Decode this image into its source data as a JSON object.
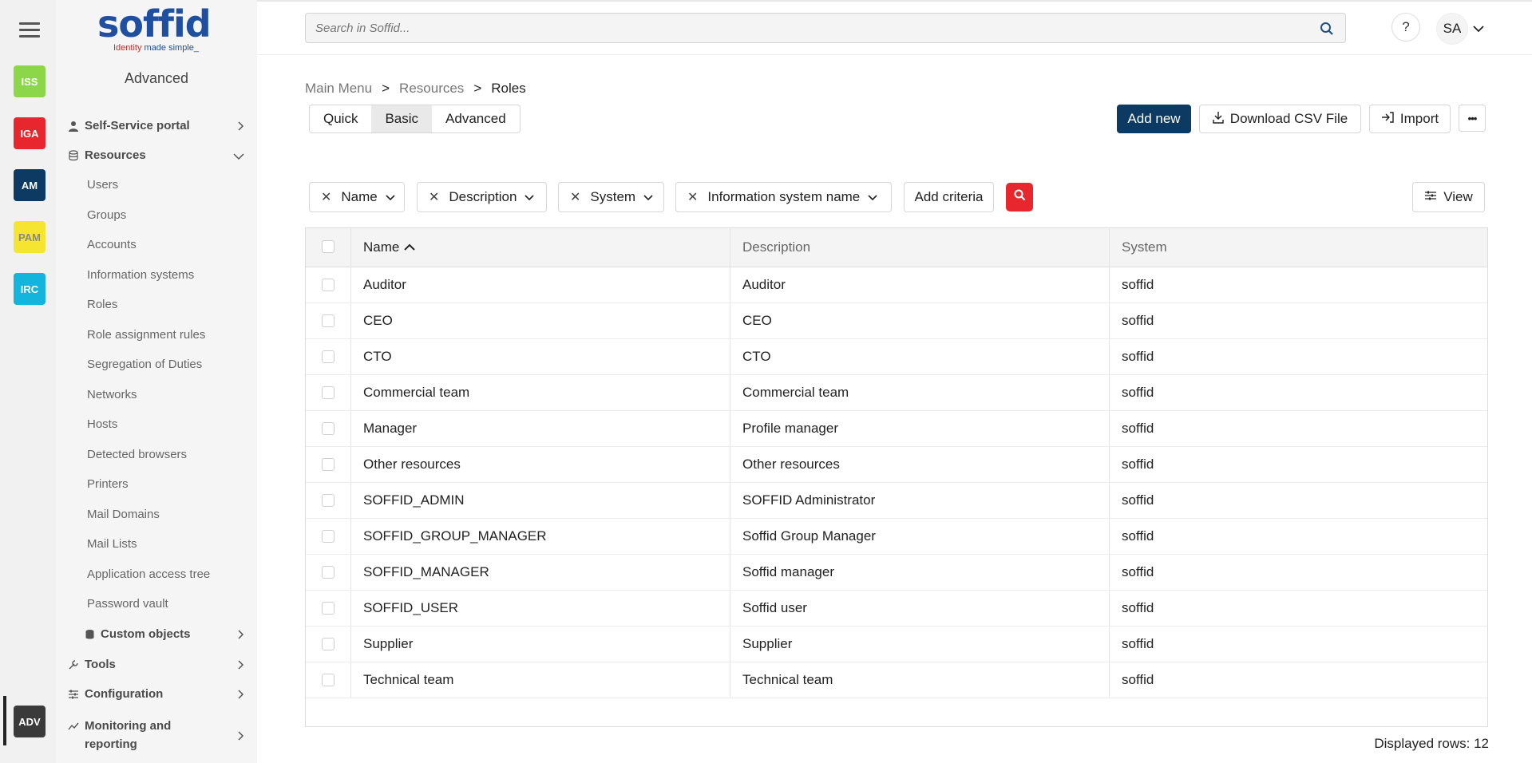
{
  "modules": [
    {
      "label": "ISS",
      "color": "#8cd64a"
    },
    {
      "label": "IGA",
      "color": "#e8262e"
    },
    {
      "label": "AM",
      "color": "#0c3a62"
    },
    {
      "label": "PAM",
      "color": "#f5e530"
    },
    {
      "label": "IRC",
      "color": "#14b5dc"
    },
    {
      "label": "ADV",
      "color": "#3a3a3a"
    }
  ],
  "logo": {
    "word": "soffid",
    "tag_red": "Identity ",
    "tag_blue": "made simple_"
  },
  "sidebar": {
    "title": "Advanced",
    "self_service": "Self-Service portal",
    "resources": "Resources",
    "items": [
      "Users",
      "Groups",
      "Accounts",
      "Information systems",
      "Roles",
      "Role assignment rules",
      "Segregation of Duties",
      "Networks",
      "Hosts",
      "Detected browsers",
      "Printers",
      "Mail Domains",
      "Mail Lists",
      "Application access tree",
      "Password vault"
    ],
    "custom_objects": "Custom objects",
    "tools": "Tools",
    "configuration": "Configuration",
    "monitoring": "Monitoring and reporting"
  },
  "search": {
    "placeholder": "Search in Soffid..."
  },
  "help_label": "?",
  "user_initials": "SA",
  "breadcrumb": {
    "main": "Main Menu",
    "sep": ">",
    "section": "Resources",
    "current": "Roles"
  },
  "modes": {
    "quick": "Quick",
    "basic": "Basic",
    "advanced": "Advanced"
  },
  "actions": {
    "add_new": "Add new",
    "download": "Download CSV File",
    "import": "Import",
    "more": "•••"
  },
  "filters": [
    "Name",
    "Description",
    "System",
    "Information system name"
  ],
  "add_criteria": "Add criteria",
  "view_label": "View",
  "table": {
    "columns": {
      "name": "Name",
      "description": "Description",
      "system": "System"
    },
    "rows": [
      {
        "name": "Auditor",
        "description": "Auditor",
        "system": "soffid"
      },
      {
        "name": "CEO",
        "description": "CEO",
        "system": "soffid"
      },
      {
        "name": "CTO",
        "description": "CTO",
        "system": "soffid"
      },
      {
        "name": "Commercial team",
        "description": "Commercial team",
        "system": "soffid"
      },
      {
        "name": "Manager",
        "description": "Profile manager",
        "system": "soffid"
      },
      {
        "name": "Other resources",
        "description": "Other resources",
        "system": "soffid"
      },
      {
        "name": "SOFFID_ADMIN",
        "description": "SOFFID Administrator",
        "system": "soffid"
      },
      {
        "name": "SOFFID_GROUP_MANAGER",
        "description": "Soffid Group Manager",
        "system": "soffid"
      },
      {
        "name": "SOFFID_MANAGER",
        "description": "Soffid manager",
        "system": "soffid"
      },
      {
        "name": "SOFFID_USER",
        "description": "Soffid user",
        "system": "soffid"
      },
      {
        "name": "Supplier",
        "description": "Supplier",
        "system": "soffid"
      },
      {
        "name": "Technical team",
        "description": "Technical team",
        "system": "soffid"
      }
    ]
  },
  "footer": "Displayed rows: 12"
}
